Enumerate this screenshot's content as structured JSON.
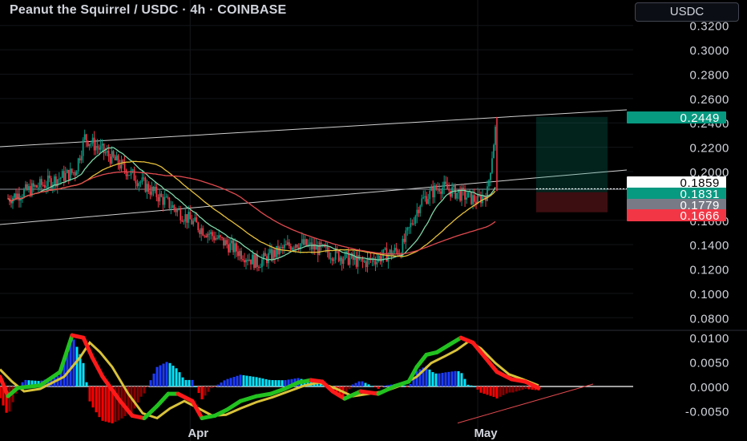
{
  "title": "Peanut the Squirrel / USDC · 4h · COINBASE",
  "currency_button": "USDC",
  "colors": {
    "background": "#000000",
    "up_candle": "#089981",
    "down_candle": "#f23645",
    "ma_fast": "#7ed6a8",
    "ma_mid": "#e6c03a",
    "ma_slow": "#e0494e",
    "macd_up": "#22c21f",
    "macd_down": "#ff1a1a",
    "macd_signal": "#d8c23a",
    "hist_pos_strong": "#1e3cff",
    "hist_pos_weak": "#00e5ff",
    "hist_neg_strong": "#ff0000",
    "hist_neg_weak": "#8b0000"
  },
  "chart_data": [
    {
      "type": "candlestick",
      "title": "Peanut the Squirrel / USDC · 4h · COINBASE",
      "ylim": [
        0.06,
        0.33
      ],
      "yticks": [
        "0.3200",
        "0.3000",
        "0.2800",
        "0.2600",
        "0.2400",
        "0.2200",
        "0.2000",
        "0.1600",
        "0.1400",
        "0.1200",
        "0.1000",
        "0.0800"
      ],
      "xtick_labels": [
        {
          "label": "Apr",
          "x": "2025-04-01"
        },
        {
          "label": "May",
          "x": "2025-05-01"
        }
      ],
      "x_range": [
        "2025-03-13",
        "2025-05-09"
      ],
      "price_labels": [
        {
          "value": "0.2449",
          "kind": "target",
          "color": "#089981"
        },
        {
          "value": "0.1859",
          "kind": "last",
          "color": "#ffffff"
        },
        {
          "value": "0.1831",
          "kind": "entry",
          "color": "#089981"
        },
        {
          "value": "0.1779",
          "kind": "prev",
          "color": "#787b86"
        },
        {
          "value": "0.1666",
          "kind": "stop",
          "color": "#f23645"
        }
      ],
      "key_closes": [
        {
          "x": "2025-03-13",
          "y": 0.178
        },
        {
          "x": "2025-03-20",
          "y": 0.2
        },
        {
          "x": "2025-03-21",
          "y": 0.228
        },
        {
          "x": "2025-03-24",
          "y": 0.21
        },
        {
          "x": "2025-03-28",
          "y": 0.184
        },
        {
          "x": "2025-04-02",
          "y": 0.154
        },
        {
          "x": "2025-04-08",
          "y": 0.125
        },
        {
          "x": "2025-04-12",
          "y": 0.142
        },
        {
          "x": "2025-04-19",
          "y": 0.125
        },
        {
          "x": "2025-04-23",
          "y": 0.136
        },
        {
          "x": "2025-04-25",
          "y": 0.175
        },
        {
          "x": "2025-04-27",
          "y": 0.188
        },
        {
          "x": "2025-05-01",
          "y": 0.176
        },
        {
          "x": "2025-05-02",
          "y": 0.183
        },
        {
          "x": "2025-05-03",
          "y": 0.245
        }
      ],
      "position": {
        "entry": 0.1831,
        "target": 0.2449,
        "stop": 0.1666
      }
    },
    {
      "type": "line",
      "title": "MACD",
      "ylim": [
        -0.0085,
        0.0115
      ],
      "yticks": [
        "0.0100",
        "0.0050",
        "0.0000",
        "-0.0050"
      ],
      "series": [
        {
          "key": "macd",
          "values": [
            [
              0,
              0.002
            ],
            [
              10,
              -0.002
            ],
            [
              22,
              -0.0003
            ],
            [
              50,
              0.0002
            ],
            [
              75,
              0.003
            ],
            [
              90,
              0.0105
            ],
            [
              104,
              0.01
            ],
            [
              115,
              0.006
            ],
            [
              128,
              0.002
            ],
            [
              150,
              -0.003
            ],
            [
              165,
              -0.006
            ],
            [
              180,
              -0.0065
            ],
            [
              196,
              -0.004
            ],
            [
              210,
              -0.0015
            ],
            [
              222,
              -0.0015
            ],
            [
              240,
              -0.003
            ],
            [
              252,
              -0.0065
            ],
            [
              268,
              -0.006
            ],
            [
              283,
              -0.0048
            ],
            [
              300,
              -0.003
            ],
            [
              320,
              -0.002
            ],
            [
              338,
              -0.0015
            ],
            [
              355,
              -0.0005
            ],
            [
              372,
              0.0008
            ],
            [
              388,
              0.0013
            ],
            [
              402,
              0.001
            ],
            [
              415,
              -0.001
            ],
            [
              430,
              -0.0025
            ],
            [
              450,
              -0.001
            ],
            [
              472,
              -0.0015
            ],
            [
              493,
              0.0001
            ],
            [
              510,
              0.001
            ],
            [
              520,
              0.004
            ],
            [
              532,
              0.0065
            ],
            [
              545,
              0.007
            ],
            [
              560,
              0.0085
            ],
            [
              575,
              0.01
            ],
            [
              590,
              0.009
            ],
            [
              605,
              0.006
            ],
            [
              620,
              0.003
            ],
            [
              638,
              0.0015
            ],
            [
              655,
              0.001
            ],
            [
              672,
              -0.0003
            ]
          ]
        },
        {
          "key": "signal",
          "values": [
            [
              0,
              0.0035
            ],
            [
              15,
              0.001
            ],
            [
              30,
              -0.001
            ],
            [
              50,
              -0.0005
            ],
            [
              80,
              0.002
            ],
            [
              100,
              0.006
            ],
            [
              112,
              0.009
            ],
            [
              125,
              0.007
            ],
            [
              140,
              0.004
            ],
            [
              160,
              -0.0015
            ],
            [
              178,
              -0.0055
            ],
            [
              196,
              -0.0065
            ],
            [
              212,
              -0.0045
            ],
            [
              230,
              -0.003
            ],
            [
              248,
              -0.0045
            ],
            [
              265,
              -0.006
            ],
            [
              282,
              -0.0058
            ],
            [
              300,
              -0.0045
            ],
            [
              320,
              -0.0032
            ],
            [
              340,
              -0.0022
            ],
            [
              360,
              -0.001
            ],
            [
              380,
              0.0002
            ],
            [
              398,
              0.0008
            ],
            [
              420,
              -0.0005
            ],
            [
              440,
              -0.002
            ],
            [
              460,
              -0.0015
            ],
            [
              480,
              -0.001
            ],
            [
              500,
              0.0002
            ],
            [
              520,
              0.002
            ],
            [
              538,
              0.0048
            ],
            [
              555,
              0.0062
            ],
            [
              570,
              0.0075
            ],
            [
              585,
              0.0093
            ],
            [
              600,
              0.0078
            ],
            [
              618,
              0.0048
            ],
            [
              635,
              0.0025
            ],
            [
              652,
              0.0015
            ],
            [
              672,
              0.0002
            ]
          ]
        }
      ],
      "trend_line": [
        [
          571,
          -0.0075
        ],
        [
          740,
          0.0005
        ]
      ]
    }
  ],
  "axis_labels": {
    "x_apr": "Apr",
    "x_may": "May",
    "price": [
      "0.3200",
      "0.3000",
      "0.2800",
      "0.2600",
      "0.2400",
      "0.2200",
      "0.2000",
      "0.1600",
      "0.1400",
      "0.1200",
      "0.1000",
      "0.0800"
    ],
    "macd": [
      "0.0100",
      "0.0050",
      "0.0000",
      "-0.0050"
    ]
  }
}
